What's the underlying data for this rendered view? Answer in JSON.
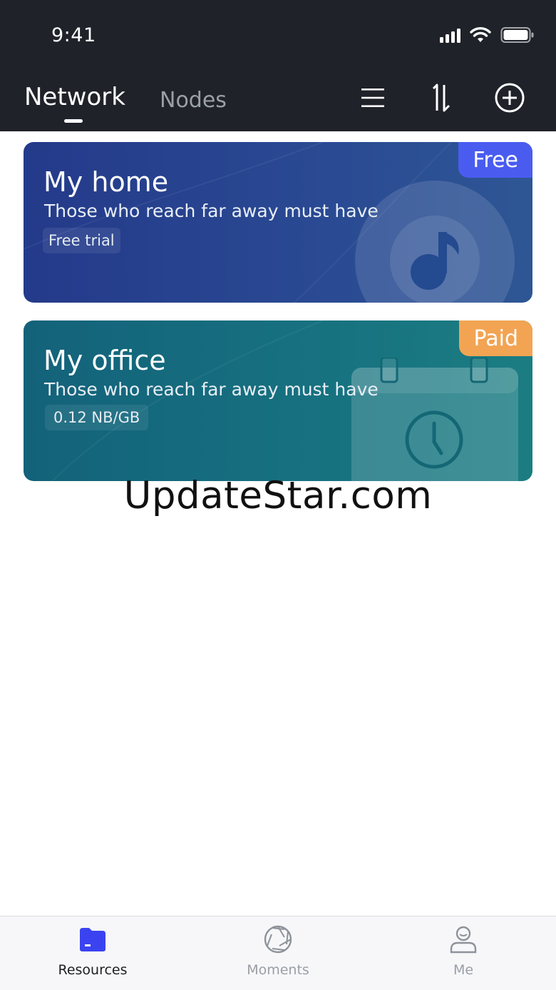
{
  "status_bar": {
    "time": "9:41"
  },
  "top_nav": {
    "tabs": [
      {
        "label": "Network",
        "active": true
      },
      {
        "label": "Nodes",
        "active": false
      }
    ],
    "icons": [
      "menu-icon",
      "sort-icon",
      "add-circle-icon"
    ]
  },
  "cards": [
    {
      "title": "My home",
      "subtitle": "Those who reach far away must have",
      "tag": "Free trial",
      "badge": "Free",
      "icon": "music-note-icon"
    },
    {
      "title": "My office",
      "subtitle": "Those who reach far away must have",
      "tag": "0.12 NB/GB",
      "badge": "Paid",
      "icon": "calendar-clock-icon"
    }
  ],
  "watermark": "UpdateStar.com",
  "bottom_tabs": [
    {
      "label": "Resources",
      "icon": "folder-icon",
      "active": true
    },
    {
      "label": "Moments",
      "icon": "aperture-icon",
      "active": false
    },
    {
      "label": "Me",
      "icon": "user-icon",
      "active": false
    }
  ],
  "colors": {
    "header_bg": "#1f2229",
    "badge_free": "#4a5cf0",
    "badge_paid": "#f2a453",
    "active_tab_icon": "#3b43f0"
  }
}
